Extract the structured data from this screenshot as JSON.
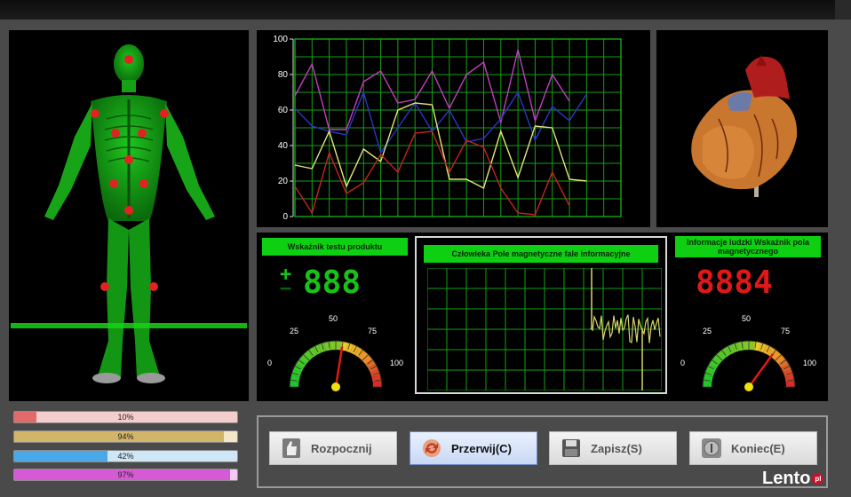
{
  "chart_data": {
    "type": "line",
    "x": [
      0,
      1,
      2,
      3,
      4,
      5,
      6,
      7,
      8,
      9,
      10,
      11,
      12,
      13,
      14,
      15,
      16,
      17,
      18,
      19
    ],
    "ylim": [
      0,
      100
    ],
    "yticks": [
      "0",
      "20",
      "40",
      "60",
      "80",
      "100"
    ],
    "grid": true,
    "series": [
      {
        "color": "#c23ec2",
        "values": [
          68,
          86,
          49,
          49,
          76,
          82,
          64,
          66,
          82,
          61,
          80,
          87,
          53,
          94,
          54,
          80,
          65
        ]
      },
      {
        "color": "#2a37c7",
        "values": [
          61,
          51,
          48,
          46,
          70,
          36,
          50,
          64,
          48,
          60,
          42,
          44,
          55,
          70,
          43,
          62,
          54,
          69
        ]
      },
      {
        "color": "#e4e47a",
        "values": [
          29,
          27,
          48,
          17,
          38,
          31,
          60,
          64,
          63,
          21,
          21,
          16,
          48,
          22,
          51,
          50,
          21,
          20
        ]
      },
      {
        "color": "#c32424",
        "values": [
          17,
          2,
          36,
          13,
          19,
          35,
          25,
          47,
          48,
          25,
          43,
          39,
          16,
          2,
          1,
          25,
          6
        ]
      }
    ]
  },
  "colors": {
    "panel_bg": "#000000",
    "accent_green": "#0fcf12",
    "digit_green": "#19c219",
    "digit_red": "#e01818"
  },
  "product_test": {
    "title": "Wskaźnik testu produktu",
    "value": "888",
    "gauge_value": 55,
    "gauge_labels": {
      "min": "0",
      "q1": "25",
      "mid": "50",
      "q3": "75",
      "max": "100"
    }
  },
  "magnetic_wave": {
    "title": "Człowieka Pole magnetyczne fale informacyjne"
  },
  "human_field": {
    "title": "Informacje ludzki Wskaźnik pola magnetycznego",
    "value": "8884",
    "gauge_value": 70,
    "gauge_labels": {
      "min": "0",
      "q1": "25",
      "mid": "50",
      "q3": "75",
      "max": "100"
    }
  },
  "progress_bars": [
    {
      "label": "10%",
      "value": 10,
      "color": "#e16a6a",
      "bg": "#f4cdcd"
    },
    {
      "label": "94%",
      "value": 94,
      "color": "#d3b56a",
      "bg": "#f3e7c8"
    },
    {
      "label": "42%",
      "value": 42,
      "color": "#4aa8e8",
      "bg": "#cfe6f6"
    },
    {
      "label": "97%",
      "value": 97,
      "color": "#d65ad6",
      "bg": "#f3c9f3"
    }
  ],
  "buttons": {
    "start": "Rozpocznij",
    "pause": "Przerwij(C)",
    "save": "Zapisz(S)",
    "end": "Koniec(E)"
  },
  "watermark": {
    "brand": "Lento",
    "suffix": "pl"
  }
}
